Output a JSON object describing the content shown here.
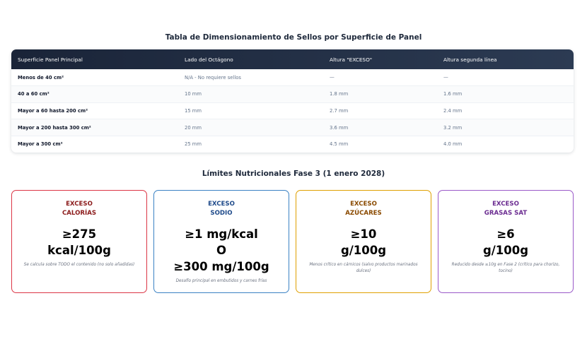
{
  "table_section": {
    "title": "Tabla de Dimensionamiento de Sellos por Superficie de Panel",
    "headers": [
      "Superficie Panel Principal",
      "Lado del Octágono",
      "Altura \"EXCESO\"",
      "Altura segunda línea"
    ],
    "rows": [
      [
        "Menos de 40 cm²",
        "N/A - No requiere sellos",
        "—",
        "—"
      ],
      [
        "40 a 60 cm²",
        "10 mm",
        "1.8 mm",
        "1.6 mm"
      ],
      [
        "Mayor a 60 hasta 200 cm²",
        "15 mm",
        "2.7 mm",
        "2.4 mm"
      ],
      [
        "Mayor a 200 hasta 300 cm²",
        "20 mm",
        "3.6 mm",
        "3.2 mm"
      ],
      [
        "Mayor a 300 cm²",
        "25 mm",
        "4.5 mm",
        "4.0 mm"
      ]
    ]
  },
  "limits_section": {
    "title": "Límites Nutricionales Fase 3 (1 enero 2028)",
    "cards": [
      {
        "label_line1": "EXCESO",
        "label_line2": "CALORÍAS",
        "value_lines": [
          "≥275",
          "kcal/100g"
        ],
        "note": "Se calcula sobre TODO el contenido (no solo añadidas)",
        "border_color": "#dc3545",
        "label_color": "#8b1a1a"
      },
      {
        "label_line1": "EXCESO",
        "label_line2": "SODIO",
        "value_lines": [
          "≥1 mg/kcal",
          "O",
          "≥300 mg/100g"
        ],
        "note": "Desafío principal en embutidos y carnes frías",
        "border_color": "#3b82c4",
        "label_color": "#1e4a8a"
      },
      {
        "label_line1": "EXCESO",
        "label_line2": "AZÚCARES",
        "value_lines": [
          "≥10",
          "g/100g"
        ],
        "note": "Menos crítico en cárnicos (salvo productos marinados dulces)",
        "border_color": "#e0a000",
        "label_color": "#8a4a00"
      },
      {
        "label_line1": "EXCESO",
        "label_line2": "GRASAS SAT",
        "value_lines": [
          "≥6",
          "g/100g"
        ],
        "note": "Reducido desde ≥10g en Fase 2 (crítico para chorizo, tocino)",
        "border_color": "#9a59c8",
        "label_color": "#6b2c91"
      }
    ]
  }
}
